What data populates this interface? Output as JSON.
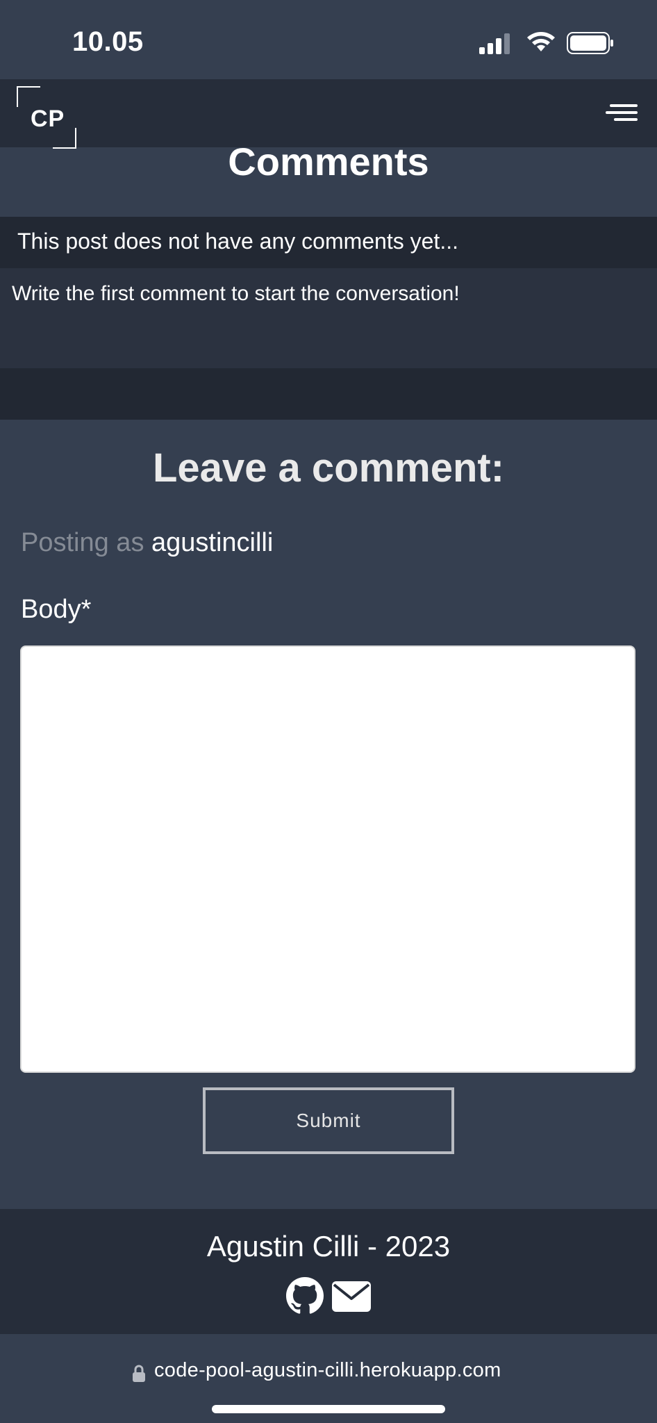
{
  "status_bar": {
    "time": "10.05",
    "icons": [
      "signal-icon",
      "wifi-icon",
      "battery-icon"
    ]
  },
  "navbar": {
    "logo_text": "CP",
    "menu_icon": "hamburger-icon"
  },
  "comments": {
    "title": "Comments",
    "empty_message": "This post does not have any comments yet...",
    "prompt": "Write the first comment to start the conversation!"
  },
  "comment_form": {
    "title": "Leave a comment:",
    "posting_prefix": "Posting as",
    "username": "agustincilli",
    "body_label": "Body*",
    "body_value": "",
    "submit_label": "Submit"
  },
  "footer": {
    "credit": "Agustin Cilli - 2023",
    "icons": [
      "github-icon",
      "mail-icon"
    ]
  },
  "browser": {
    "url": "code-pool-agustin-cilli.herokuapp.com"
  },
  "colors": {
    "page_bg": "#353f50",
    "navbar_bg": "#262d3a",
    "band_dark": "#222833",
    "muted_text": "#858b95"
  }
}
